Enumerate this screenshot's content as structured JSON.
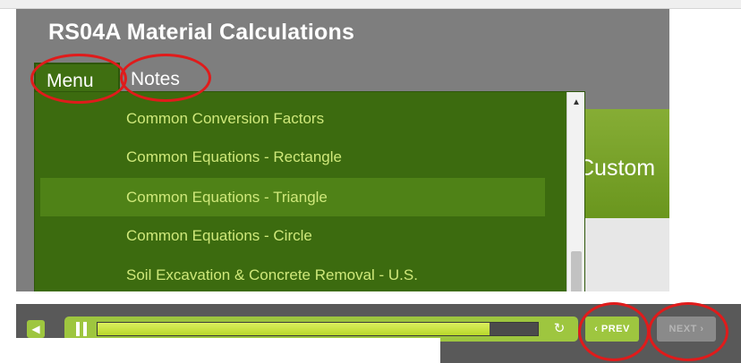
{
  "window": {
    "title": "RS04A Material Calculations"
  },
  "tabs": [
    {
      "label": "Menu"
    },
    {
      "label": "Notes"
    }
  ],
  "menu_items": [
    {
      "label": "Common Conversion Factors"
    },
    {
      "label": "Common Equations - Rectangle"
    },
    {
      "label": "Common Equations - Triangle"
    },
    {
      "label": "Common Equations - Circle"
    },
    {
      "label": "Soil Excavation & Concrete Removal - U.S."
    }
  ],
  "selected_menu_item": "Common Equations - Triangle",
  "content_fragment": "Custom",
  "player": {
    "progress_percent": 89,
    "prev_label": "PREV",
    "next_label": "NEXT",
    "volume_icon": "speaker-icon",
    "pause_icon": "pause-icon",
    "reload_icon": "reload-icon"
  },
  "colors": {
    "menu_bg": "#3c6b0f",
    "menu_selected": "#4f8217",
    "menu_text": "#cfe87a",
    "accent_green": "#9ec63f",
    "annotation_red": "#e01b1b"
  }
}
